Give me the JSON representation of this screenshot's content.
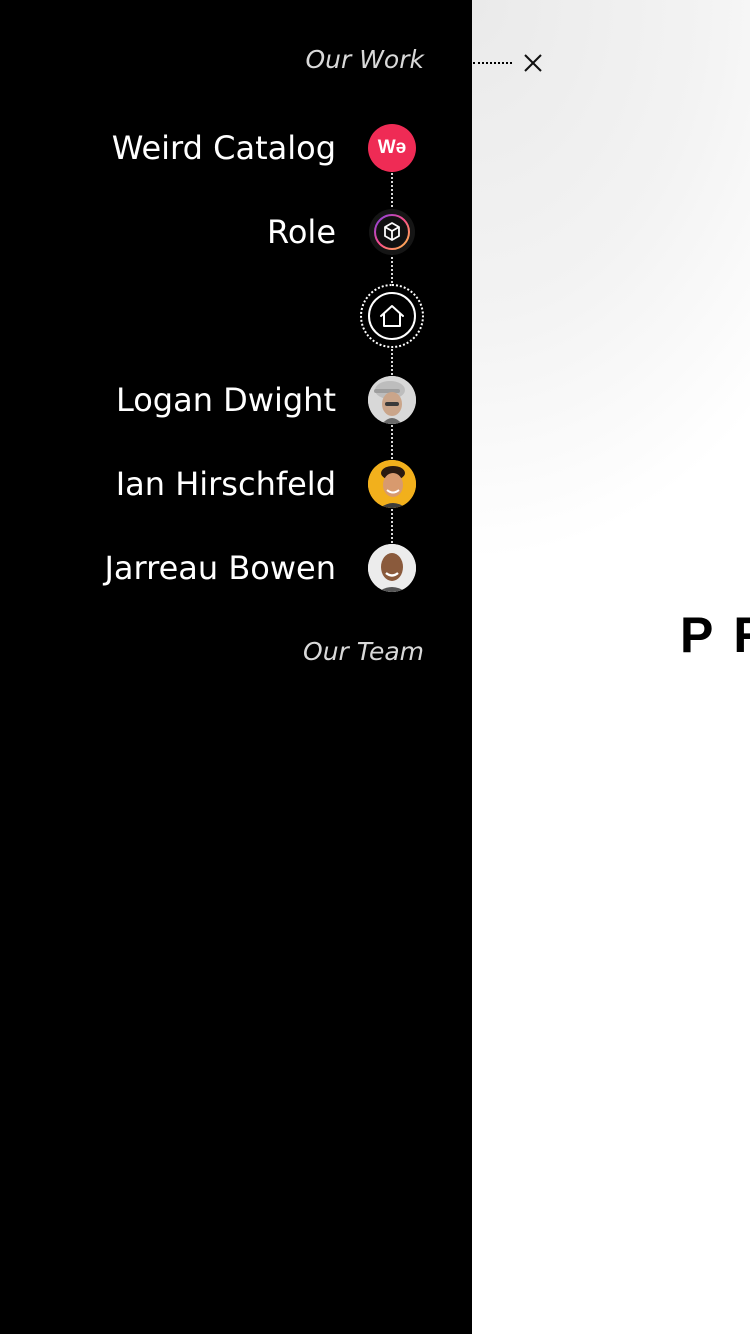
{
  "menu": {
    "section_top": "Our Work",
    "section_bottom": "Our Team",
    "items": [
      {
        "label": "Weird Catalog",
        "icon": "weird-catalog-logo",
        "badge_text": "Wə",
        "color": "#ef2b55"
      },
      {
        "label": "Role",
        "icon": "role-cube-logo"
      },
      {
        "label": "",
        "icon": "home-icon"
      },
      {
        "label": "Logan Dwight",
        "icon": "avatar-logan-dwight"
      },
      {
        "label": "Ian Hirschfeld",
        "icon": "avatar-ian-hirschfeld"
      },
      {
        "label": "Jarreau Bowen",
        "icon": "avatar-jarreau-bowen"
      }
    ]
  },
  "content": {
    "headline": "PR"
  },
  "colors": {
    "drawer_bg": "#000000",
    "accent": "#ef2b55",
    "text": "#ffffff",
    "muted": "#d9d9d9"
  }
}
